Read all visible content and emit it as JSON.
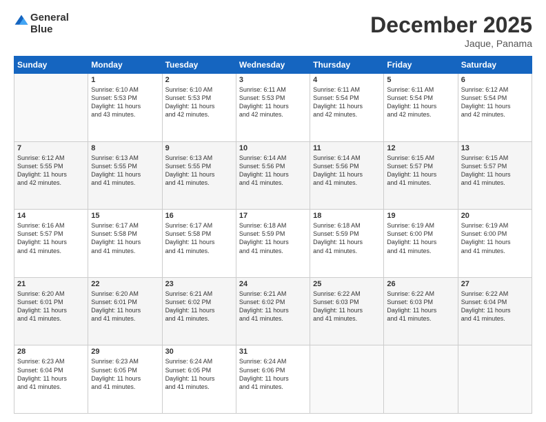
{
  "logo": {
    "line1": "General",
    "line2": "Blue"
  },
  "title": "December 2025",
  "subtitle": "Jaque, Panama",
  "days_of_week": [
    "Sunday",
    "Monday",
    "Tuesday",
    "Wednesday",
    "Thursday",
    "Friday",
    "Saturday"
  ],
  "weeks": [
    [
      {
        "day": "",
        "info": ""
      },
      {
        "day": "1",
        "info": "Sunrise: 6:10 AM\nSunset: 5:53 PM\nDaylight: 11 hours\nand 43 minutes."
      },
      {
        "day": "2",
        "info": "Sunrise: 6:10 AM\nSunset: 5:53 PM\nDaylight: 11 hours\nand 42 minutes."
      },
      {
        "day": "3",
        "info": "Sunrise: 6:11 AM\nSunset: 5:53 PM\nDaylight: 11 hours\nand 42 minutes."
      },
      {
        "day": "4",
        "info": "Sunrise: 6:11 AM\nSunset: 5:54 PM\nDaylight: 11 hours\nand 42 minutes."
      },
      {
        "day": "5",
        "info": "Sunrise: 6:11 AM\nSunset: 5:54 PM\nDaylight: 11 hours\nand 42 minutes."
      },
      {
        "day": "6",
        "info": "Sunrise: 6:12 AM\nSunset: 5:54 PM\nDaylight: 11 hours\nand 42 minutes."
      }
    ],
    [
      {
        "day": "7",
        "info": "Sunrise: 6:12 AM\nSunset: 5:55 PM\nDaylight: 11 hours\nand 42 minutes."
      },
      {
        "day": "8",
        "info": "Sunrise: 6:13 AM\nSunset: 5:55 PM\nDaylight: 11 hours\nand 41 minutes."
      },
      {
        "day": "9",
        "info": "Sunrise: 6:13 AM\nSunset: 5:55 PM\nDaylight: 11 hours\nand 41 minutes."
      },
      {
        "day": "10",
        "info": "Sunrise: 6:14 AM\nSunset: 5:56 PM\nDaylight: 11 hours\nand 41 minutes."
      },
      {
        "day": "11",
        "info": "Sunrise: 6:14 AM\nSunset: 5:56 PM\nDaylight: 11 hours\nand 41 minutes."
      },
      {
        "day": "12",
        "info": "Sunrise: 6:15 AM\nSunset: 5:57 PM\nDaylight: 11 hours\nand 41 minutes."
      },
      {
        "day": "13",
        "info": "Sunrise: 6:15 AM\nSunset: 5:57 PM\nDaylight: 11 hours\nand 41 minutes."
      }
    ],
    [
      {
        "day": "14",
        "info": "Sunrise: 6:16 AM\nSunset: 5:57 PM\nDaylight: 11 hours\nand 41 minutes."
      },
      {
        "day": "15",
        "info": "Sunrise: 6:17 AM\nSunset: 5:58 PM\nDaylight: 11 hours\nand 41 minutes."
      },
      {
        "day": "16",
        "info": "Sunrise: 6:17 AM\nSunset: 5:58 PM\nDaylight: 11 hours\nand 41 minutes."
      },
      {
        "day": "17",
        "info": "Sunrise: 6:18 AM\nSunset: 5:59 PM\nDaylight: 11 hours\nand 41 minutes."
      },
      {
        "day": "18",
        "info": "Sunrise: 6:18 AM\nSunset: 5:59 PM\nDaylight: 11 hours\nand 41 minutes."
      },
      {
        "day": "19",
        "info": "Sunrise: 6:19 AM\nSunset: 6:00 PM\nDaylight: 11 hours\nand 41 minutes."
      },
      {
        "day": "20",
        "info": "Sunrise: 6:19 AM\nSunset: 6:00 PM\nDaylight: 11 hours\nand 41 minutes."
      }
    ],
    [
      {
        "day": "21",
        "info": "Sunrise: 6:20 AM\nSunset: 6:01 PM\nDaylight: 11 hours\nand 41 minutes."
      },
      {
        "day": "22",
        "info": "Sunrise: 6:20 AM\nSunset: 6:01 PM\nDaylight: 11 hours\nand 41 minutes."
      },
      {
        "day": "23",
        "info": "Sunrise: 6:21 AM\nSunset: 6:02 PM\nDaylight: 11 hours\nand 41 minutes."
      },
      {
        "day": "24",
        "info": "Sunrise: 6:21 AM\nSunset: 6:02 PM\nDaylight: 11 hours\nand 41 minutes."
      },
      {
        "day": "25",
        "info": "Sunrise: 6:22 AM\nSunset: 6:03 PM\nDaylight: 11 hours\nand 41 minutes."
      },
      {
        "day": "26",
        "info": "Sunrise: 6:22 AM\nSunset: 6:03 PM\nDaylight: 11 hours\nand 41 minutes."
      },
      {
        "day": "27",
        "info": "Sunrise: 6:22 AM\nSunset: 6:04 PM\nDaylight: 11 hours\nand 41 minutes."
      }
    ],
    [
      {
        "day": "28",
        "info": "Sunrise: 6:23 AM\nSunset: 6:04 PM\nDaylight: 11 hours\nand 41 minutes."
      },
      {
        "day": "29",
        "info": "Sunrise: 6:23 AM\nSunset: 6:05 PM\nDaylight: 11 hours\nand 41 minutes."
      },
      {
        "day": "30",
        "info": "Sunrise: 6:24 AM\nSunset: 6:05 PM\nDaylight: 11 hours\nand 41 minutes."
      },
      {
        "day": "31",
        "info": "Sunrise: 6:24 AM\nSunset: 6:06 PM\nDaylight: 11 hours\nand 41 minutes."
      },
      {
        "day": "",
        "info": ""
      },
      {
        "day": "",
        "info": ""
      },
      {
        "day": "",
        "info": ""
      }
    ]
  ]
}
